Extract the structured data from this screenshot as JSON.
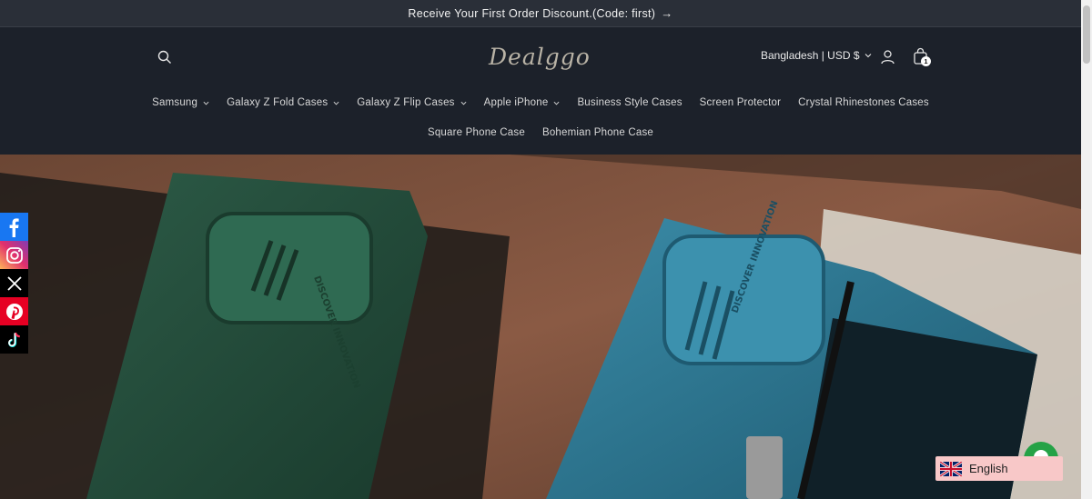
{
  "announcement": {
    "text": "Receive Your First Order Discount.(Code: first)",
    "arrow": "→"
  },
  "header": {
    "logo_text": "Dealggo",
    "locale": "Bangladesh | USD $",
    "cart_count": "1"
  },
  "nav": {
    "row1": [
      {
        "label": "Samsung",
        "dropdown": true
      },
      {
        "label": "Galaxy Z Fold Cases",
        "dropdown": true
      },
      {
        "label": "Galaxy Z Flip Cases",
        "dropdown": true
      },
      {
        "label": "Apple iPhone",
        "dropdown": true
      },
      {
        "label": "Business Style Cases",
        "dropdown": false
      },
      {
        "label": "Screen Protector",
        "dropdown": false
      },
      {
        "label": "Crystal Rhinestones Cases",
        "dropdown": false
      }
    ],
    "row2": [
      {
        "label": "Square Phone Case",
        "dropdown": false
      },
      {
        "label": "Bohemian Phone Case",
        "dropdown": false
      }
    ]
  },
  "hero": {
    "case_left_text": "DISCOVER INNOVATION",
    "case_right_text": "DISCOVER INNOVATION"
  },
  "social": [
    "facebook-icon",
    "instagram-icon",
    "x-icon",
    "pinterest-icon",
    "tiktok-icon"
  ],
  "language": {
    "label": "English"
  },
  "colors": {
    "header_bg": "#1c212a",
    "announcement_bg": "#2a2f38",
    "lang_bg": "#f8c8c8"
  }
}
